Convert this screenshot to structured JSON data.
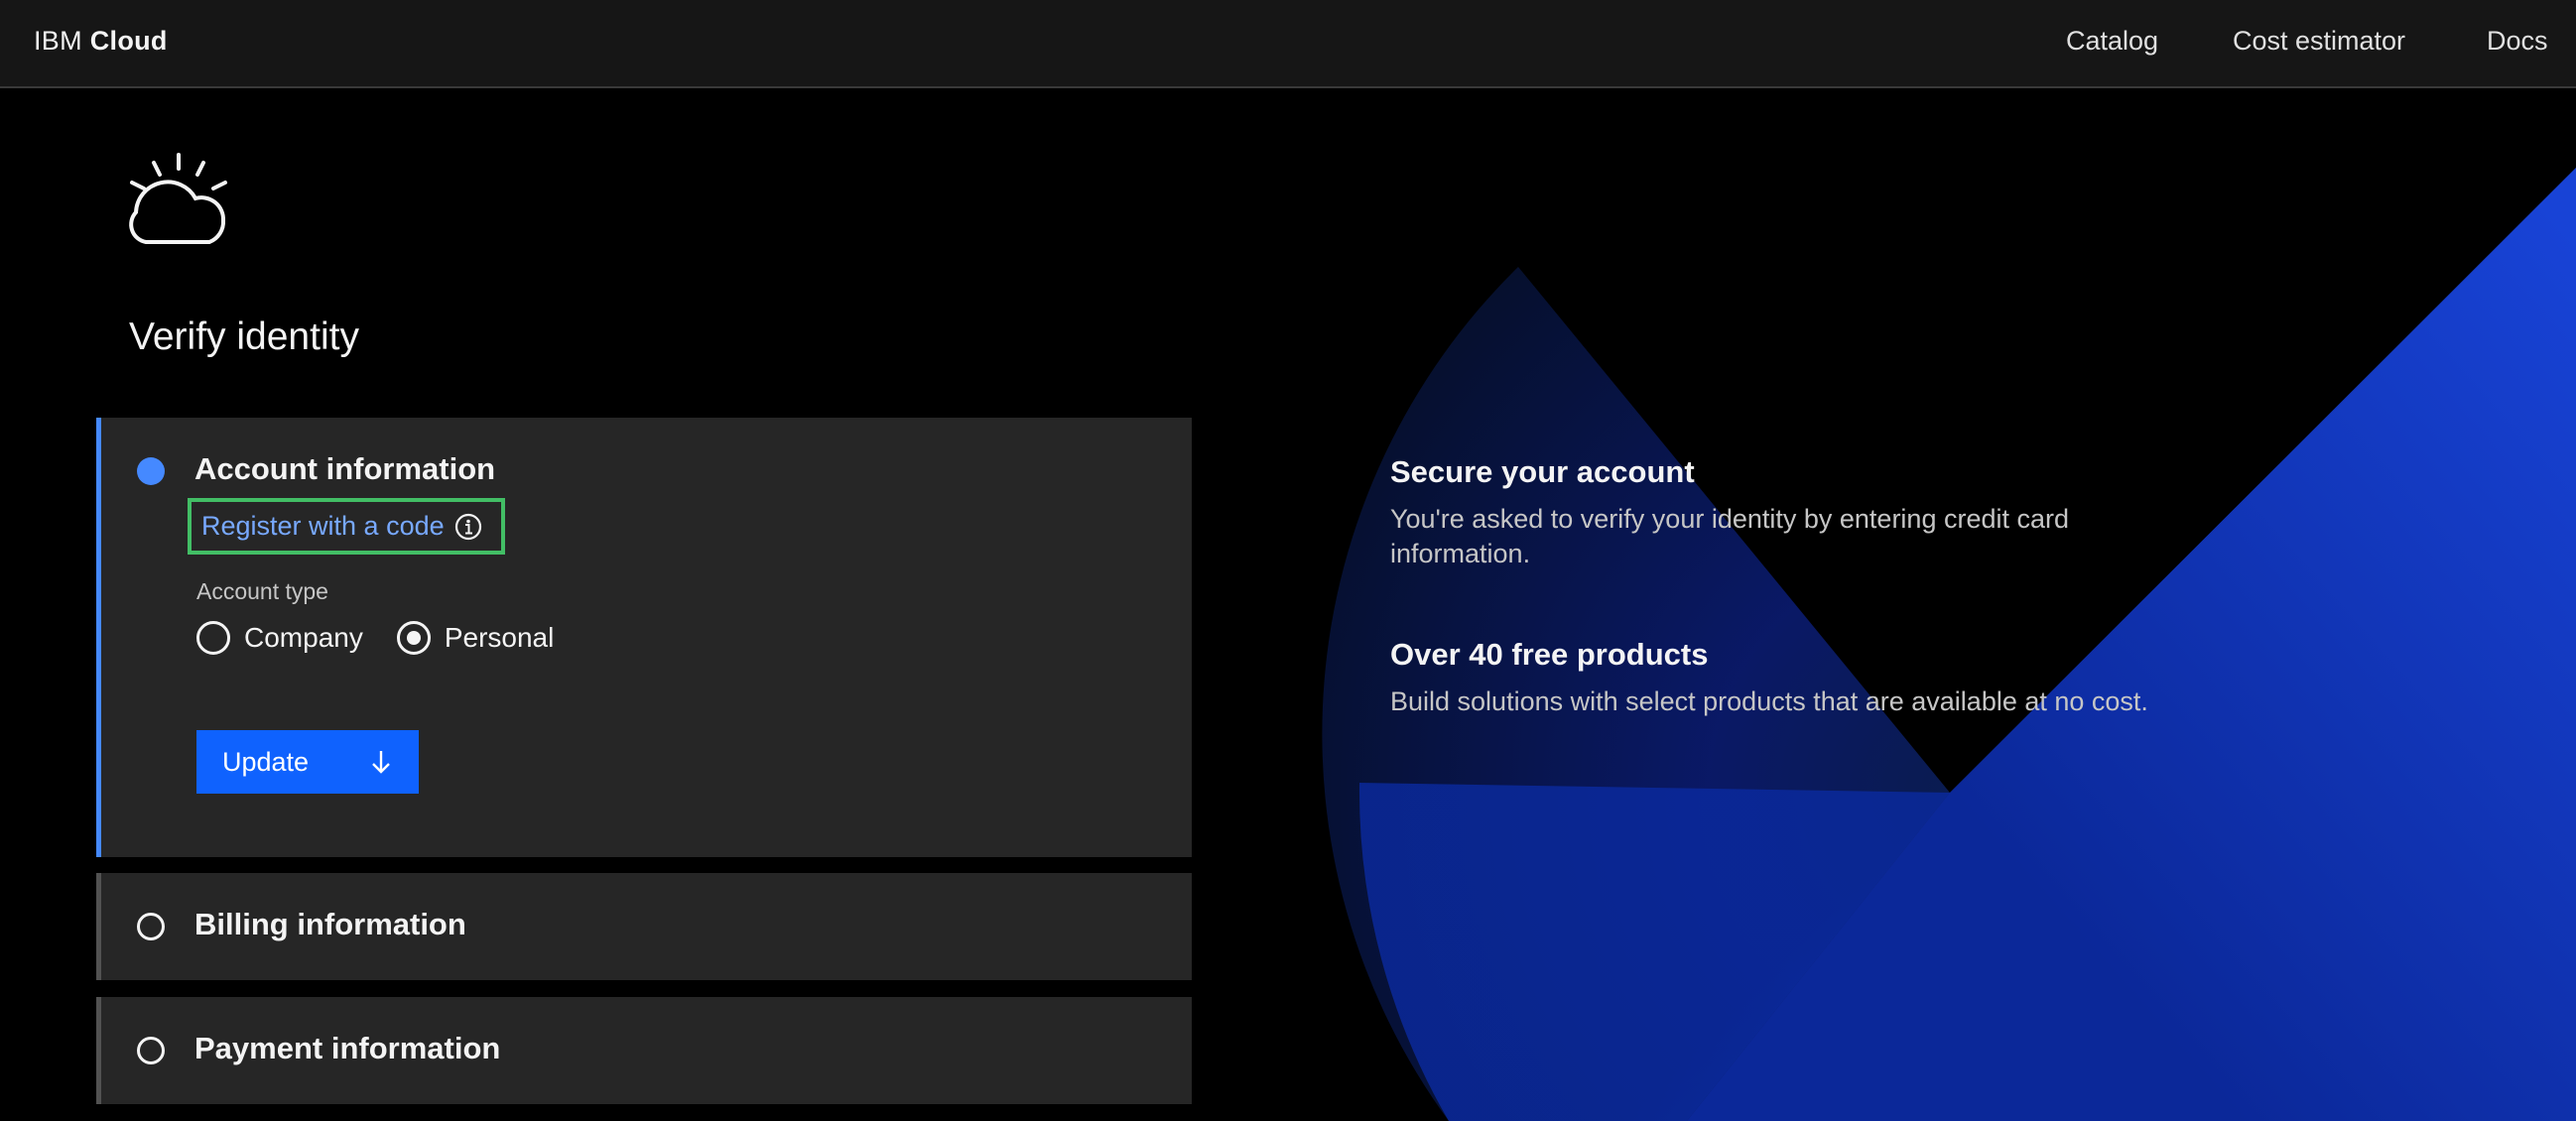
{
  "header": {
    "brand_light": "IBM",
    "brand_bold": "Cloud",
    "nav": [
      "Catalog",
      "Cost estimator",
      "Docs"
    ]
  },
  "page": {
    "title": "Verify identity",
    "logo_icon": "ibm-cloud-logo-icon"
  },
  "steps": {
    "account": {
      "title": "Account information",
      "register_link": "Register with a code",
      "info_icon": "info-icon",
      "account_type_label": "Account type",
      "options": [
        "Company",
        "Personal"
      ],
      "selected": "Personal",
      "update_button": "Update",
      "update_icon": "arrow-down-icon"
    },
    "billing": {
      "title": "Billing information"
    },
    "payment": {
      "title": "Payment information"
    }
  },
  "aside": {
    "items": [
      {
        "heading": "Secure your account",
        "text": "You're asked to verify your identity by entering credit card information."
      },
      {
        "heading": "Over 40 free products",
        "text": "Build solutions with select products that are available at no cost."
      }
    ]
  },
  "colors": {
    "accent": "#0f62fe",
    "link": "#78a9ff",
    "step_active": "#4589ff",
    "highlight": "#42be65",
    "panel_bg": "#262626",
    "header_bg": "#161616"
  }
}
